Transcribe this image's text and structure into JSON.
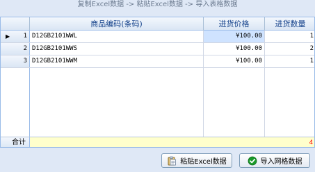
{
  "header_text": "复制Excel数据 -> 粘贴Excel数据 -> 导入表格数据",
  "columns": {
    "code": "商品编码(条码)",
    "price": "进货价格",
    "qty": "进货数量"
  },
  "rows": [
    {
      "num": "1",
      "code": "D12GB2101WWL",
      "price": "¥100.00",
      "qty": "1",
      "current": true
    },
    {
      "num": "2",
      "code": "D12GB2101WWS",
      "price": "¥100.00",
      "qty": "2",
      "current": false
    },
    {
      "num": "3",
      "code": "D12GB2101WWM",
      "price": "¥100.00",
      "qty": "1",
      "current": false
    }
  ],
  "summary": {
    "label": "合计",
    "qty_total": "4"
  },
  "buttons": {
    "paste": "粘贴Excel数据",
    "import": "导入网格数据"
  },
  "icons": {
    "current_row": "current-row-arrow-icon",
    "paste": "clipboard-paste-icon",
    "import": "check-circle-icon"
  },
  "colors": {
    "selected_cell": "#cfe3ff",
    "summary_bg": "#ffffcc",
    "summary_value": "#ff0000",
    "import_icon": "#1a9a2a"
  }
}
